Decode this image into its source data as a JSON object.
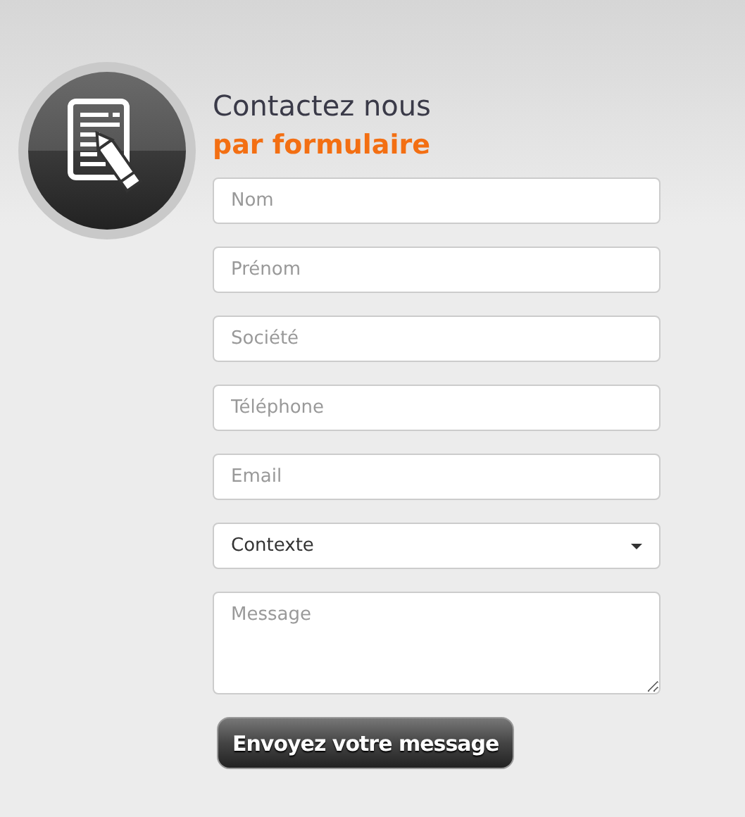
{
  "heading": {
    "title": "Contactez nous",
    "subtitle": "par formulaire"
  },
  "fields": [
    {
      "kind": "text",
      "placeholder": "Nom"
    },
    {
      "kind": "text",
      "placeholder": "Prénom"
    },
    {
      "kind": "text",
      "placeholder": "Société"
    },
    {
      "kind": "text",
      "placeholder": "Téléphone"
    },
    {
      "kind": "text",
      "placeholder": "Email"
    },
    {
      "kind": "select",
      "value": "Contexte"
    },
    {
      "kind": "textarea",
      "placeholder": "Message"
    }
  ],
  "submit": {
    "label": "Envoyez votre message"
  }
}
